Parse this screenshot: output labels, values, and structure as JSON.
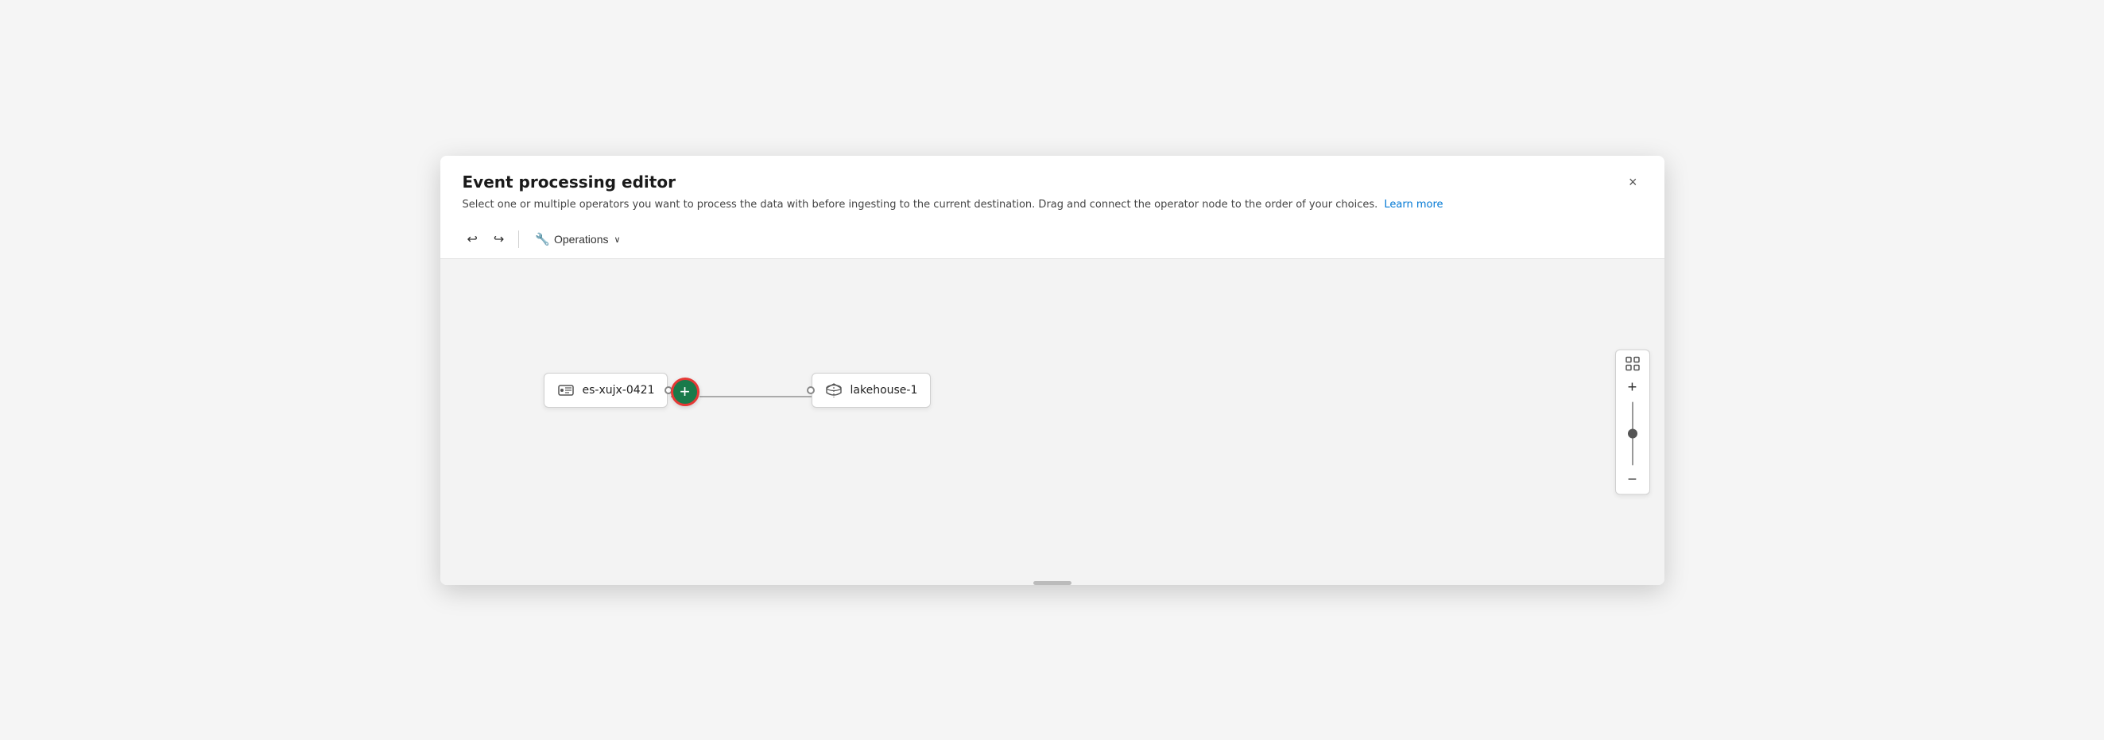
{
  "dialog": {
    "title": "Event processing editor",
    "subtitle": "Select one or multiple operators you want to process the data with before ingesting to the current destination. Drag and connect the operator node to the order of your choices.",
    "learn_more_label": "Learn more",
    "close_label": "×"
  },
  "toolbar": {
    "undo_label": "↩",
    "redo_label": "↪",
    "operations_label": "Operations",
    "chevron_label": "∨"
  },
  "canvas": {
    "source_node": {
      "label": "es-xujx-0421"
    },
    "dest_node": {
      "label": "lakehouse-1"
    },
    "add_btn_label": "+"
  },
  "zoom": {
    "fit_icon": "⛶",
    "zoom_in_label": "+",
    "zoom_out_label": "−"
  }
}
